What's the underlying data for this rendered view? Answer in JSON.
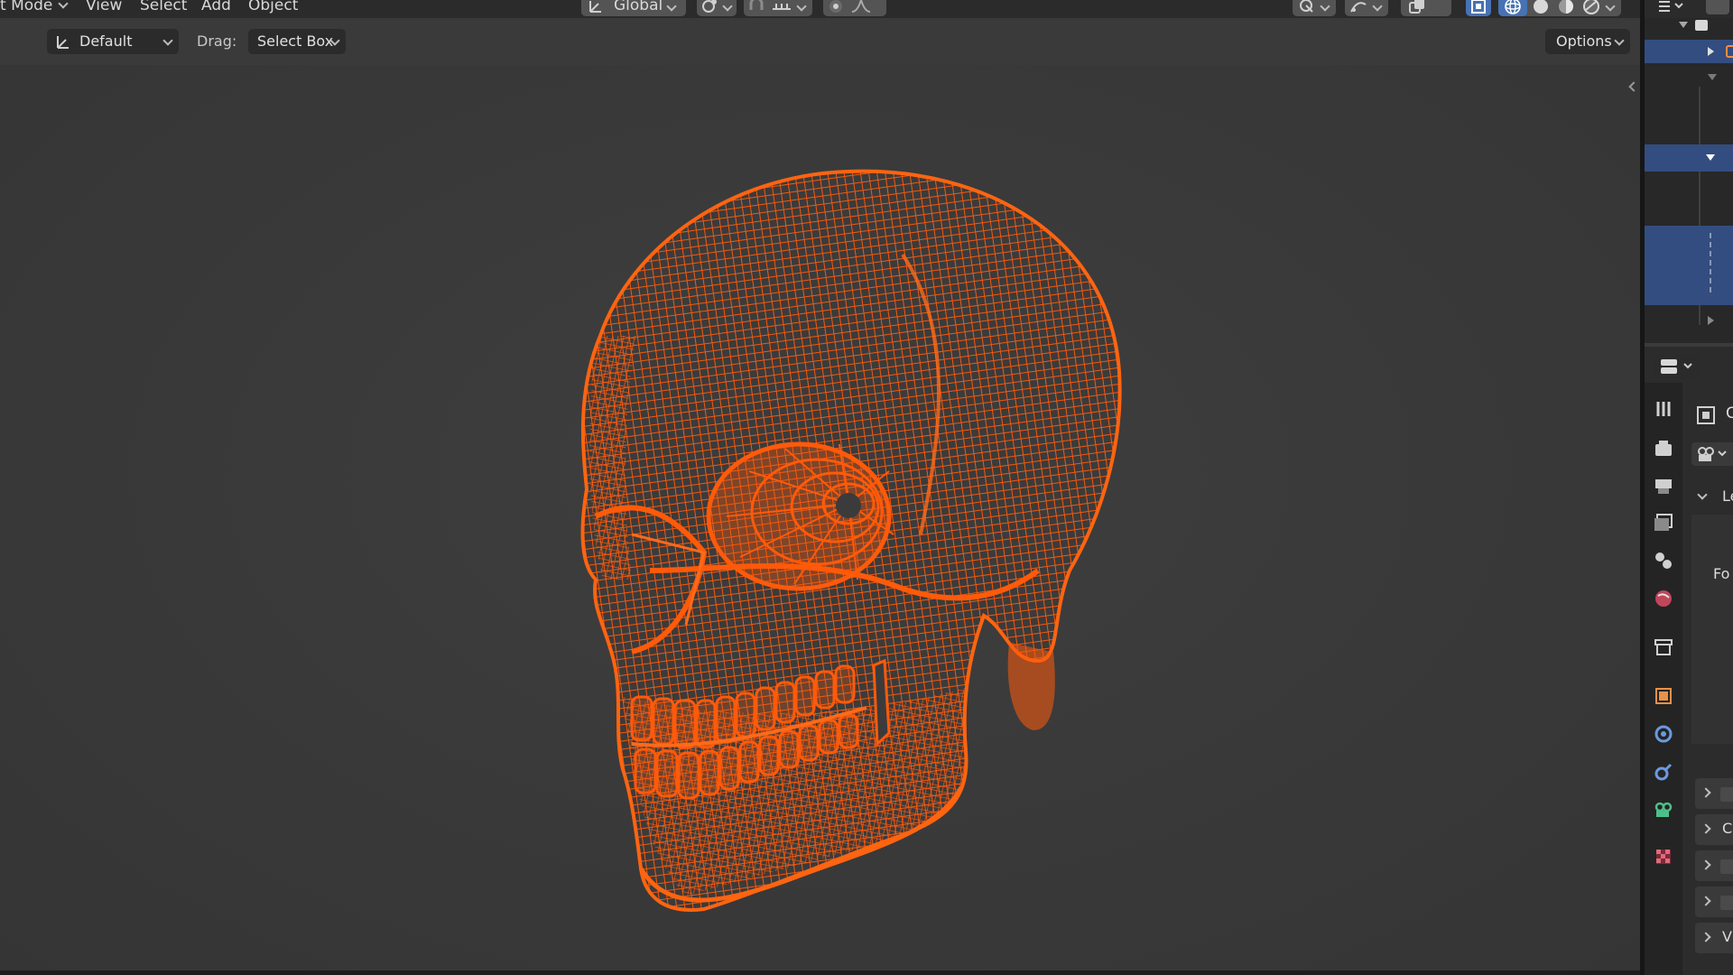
{
  "header": {
    "mode_label": "t Mode",
    "menus": [
      "View",
      "Select",
      "Add",
      "Object"
    ],
    "orientation_label": "Global"
  },
  "toolbar": {
    "orientation_value": "Default",
    "drag_label": "Drag:",
    "drag_value": "Select Box",
    "options_label": "Options"
  },
  "properties": {
    "partial_labels": [
      "C",
      "Le",
      "Fo",
      "C",
      "Vi"
    ]
  },
  "viewport": {
    "object": "skull-wireframe",
    "wire_color": "#ff5a0a",
    "background_color": "#3b3b3b"
  },
  "colors": {
    "header_bg": "#2b2b2b",
    "button_bg": "#545454",
    "selection_blue": "#4772b3",
    "outliner_selected": "#334d80"
  }
}
